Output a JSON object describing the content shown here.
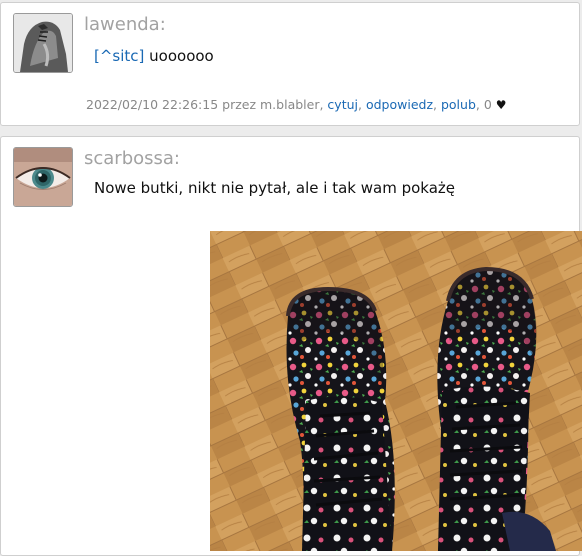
{
  "posts": [
    {
      "username": "lawenda:",
      "quote_link": "[^sitc]",
      "text": " uoooooo",
      "meta": {
        "date": "2022/02/10 22:26:15",
        "by": " przez m.blabler, ",
        "cytuj": "cytuj",
        "sep1": ", ",
        "odpowiedz": "odpowiedz",
        "sep2": ", ",
        "polub": "polub",
        "likes": ", 0 "
      },
      "like_icon": "heart-icon"
    },
    {
      "username": "scarbossa:",
      "text": "Nowe butki, nikt nie pytał, ale i tak wam pokażę",
      "image": "boots-photo"
    }
  ],
  "colors": {
    "link": "#1a69b4",
    "username": "#a2a2a2",
    "meta": "#888888"
  }
}
